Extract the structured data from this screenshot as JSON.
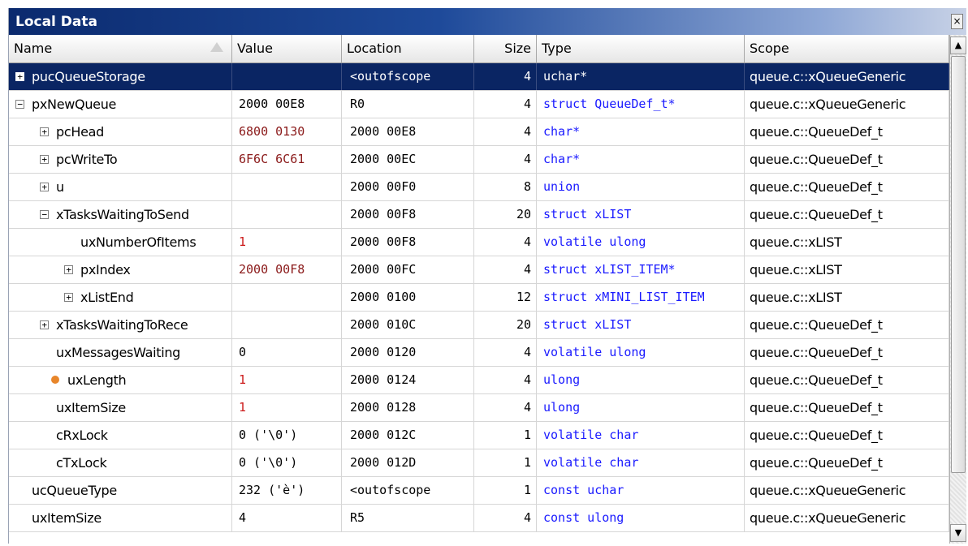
{
  "window": {
    "title": "Local Data",
    "close_label": "×"
  },
  "columns": [
    "Name",
    "Value",
    "Location",
    "Size",
    "Type",
    "Scope"
  ],
  "rows": [
    {
      "name": "pucQueueStorage",
      "value": "",
      "location": "<outofscope",
      "size": "4",
      "type": "uchar*",
      "scope": "queue.c::xQueueGeneric",
      "indent": 0,
      "toggle": "+",
      "selected": true
    },
    {
      "name": "pxNewQueue",
      "value": "2000 00E8",
      "location": "R0",
      "size": "4",
      "type": "struct QueueDef_t*",
      "scope": "queue.c::xQueueGeneric",
      "indent": 0,
      "toggle": "-"
    },
    {
      "name": "pcHead",
      "value": "6800 0130",
      "value_color": "darkred",
      "location": "2000 00E8",
      "size": "4",
      "type": "char*",
      "scope": "queue.c::QueueDef_t",
      "indent": 1,
      "toggle": "+"
    },
    {
      "name": "pcWriteTo",
      "value": "6F6C 6C61",
      "value_color": "darkred",
      "location": "2000 00EC",
      "size": "4",
      "type": "char*",
      "scope": "queue.c::QueueDef_t",
      "indent": 1,
      "toggle": "+"
    },
    {
      "name": "u",
      "value": "",
      "location": "2000 00F0",
      "size": "8",
      "type": "union",
      "scope": "queue.c::QueueDef_t",
      "indent": 1,
      "toggle": "+"
    },
    {
      "name": "xTasksWaitingToSend",
      "value": "",
      "location": "2000 00F8",
      "size": "20",
      "type": "struct xLIST",
      "scope": "queue.c::QueueDef_t",
      "indent": 1,
      "toggle": "-"
    },
    {
      "name": "uxNumberOfItems",
      "value": "1",
      "value_color": "red",
      "location": "2000 00F8",
      "size": "4",
      "type": "volatile ulong",
      "scope": "queue.c::xLIST",
      "indent": 2,
      "toggle": ""
    },
    {
      "name": "pxIndex",
      "value": "2000 00F8",
      "value_color": "darkred",
      "location": "2000 00FC",
      "size": "4",
      "type": "struct xLIST_ITEM*",
      "scope": "queue.c::xLIST",
      "indent": 2,
      "toggle": "+"
    },
    {
      "name": "xListEnd",
      "value": "",
      "location": "2000 0100",
      "size": "12",
      "type": "struct xMINI_LIST_ITEM",
      "scope": "queue.c::xLIST",
      "indent": 2,
      "toggle": "+"
    },
    {
      "name": "xTasksWaitingToRece",
      "value": "",
      "location": "2000 010C",
      "size": "20",
      "type": "struct xLIST",
      "scope": "queue.c::QueueDef_t",
      "indent": 1,
      "toggle": "+"
    },
    {
      "name": "uxMessagesWaiting",
      "value": "0",
      "location": "2000 0120",
      "size": "4",
      "type": "volatile ulong",
      "scope": "queue.c::QueueDef_t",
      "indent": 1,
      "toggle": ""
    },
    {
      "name": "uxLength",
      "value": "1",
      "value_color": "red",
      "location": "2000 0124",
      "size": "4",
      "type": "ulong",
      "scope": "queue.c::QueueDef_t",
      "indent": 1,
      "toggle": "",
      "marker": "watch-dot"
    },
    {
      "name": "uxItemSize",
      "value": "1",
      "value_color": "red",
      "location": "2000 0128",
      "size": "4",
      "type": "ulong",
      "scope": "queue.c::QueueDef_t",
      "indent": 1,
      "toggle": ""
    },
    {
      "name": "cRxLock",
      "value": "0 ('\\0')",
      "location": "2000 012C",
      "size": "1",
      "type": "volatile char",
      "scope": "queue.c::QueueDef_t",
      "indent": 1,
      "toggle": ""
    },
    {
      "name": "cTxLock",
      "value": "0 ('\\0')",
      "location": "2000 012D",
      "size": "1",
      "type": "volatile char",
      "scope": "queue.c::QueueDef_t",
      "indent": 1,
      "toggle": ""
    },
    {
      "name": "ucQueueType",
      "value": "232 ('è')",
      "location": "<outofscope",
      "size": "1",
      "type": "const uchar",
      "scope": "queue.c::xQueueGeneric",
      "indent": 0,
      "toggle": ""
    },
    {
      "name": "uxItemSize",
      "value": "4",
      "location": "R5",
      "size": "4",
      "type": "const ulong",
      "scope": "queue.c::xQueueGeneric",
      "indent": 0,
      "toggle": ""
    }
  ],
  "icons": {
    "sort": "sort-ascending-icon",
    "expand": "expand-plus-icon",
    "collapse": "collapse-minus-icon",
    "watch": "orange-dot-icon"
  },
  "colors": {
    "title_bar": "#0b2a6e",
    "selected_row": "#0a2563",
    "type_text": "#1a1aff",
    "changed_value": "#cc1a1a",
    "dark_value": "#8b1a1a"
  }
}
